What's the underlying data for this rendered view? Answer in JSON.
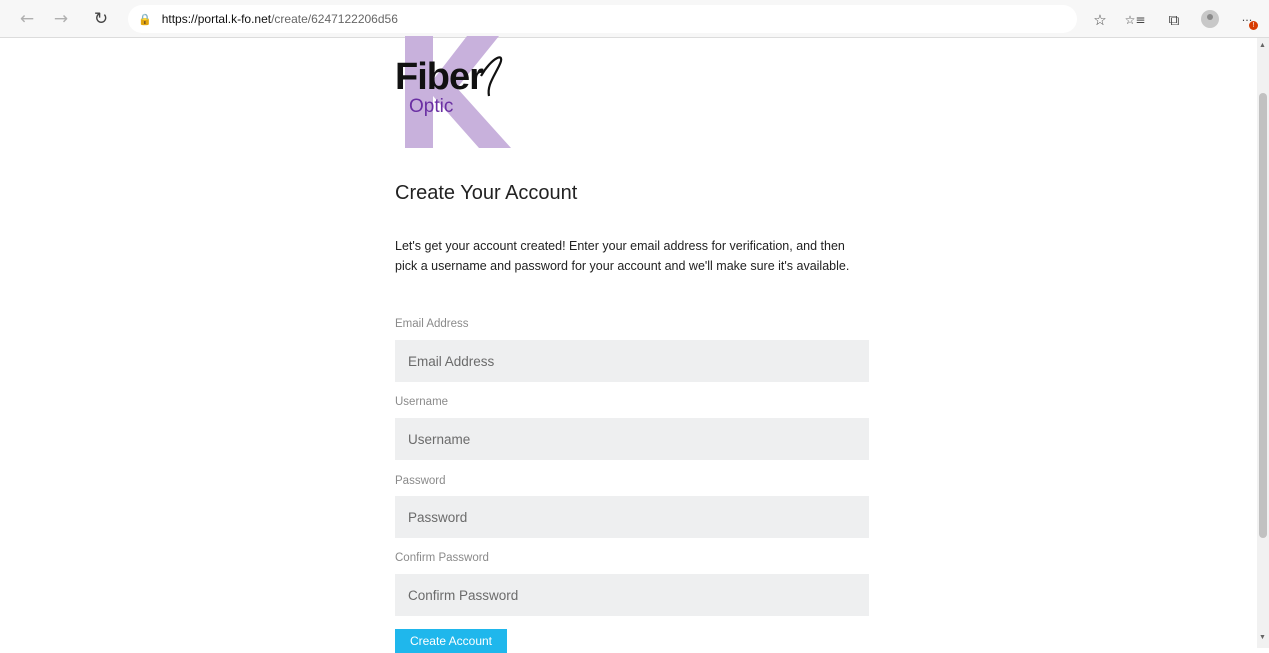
{
  "browser": {
    "back_icon": "←",
    "forward_icon": "→",
    "refresh_icon": "↻",
    "lock_icon": "🔒",
    "url_host": "https://portal.k-fo.net",
    "url_path": "/create/6247122206d56",
    "star_icon": "☆",
    "favorites_icon": "☆≡",
    "collections_icon": "⧉",
    "more_icon": "···",
    "badge_count": "!"
  },
  "logo": {
    "line1": "Fiber",
    "line2": "Optic",
    "monogram": "K",
    "colors": {
      "monogram": "#c8b1dc",
      "optic": "#6a2fa3"
    }
  },
  "form": {
    "title": "Create Your Account",
    "intro": "Let's get your account created! Enter your email address for verification, and then pick a username and password for your account and we'll make sure it's available.",
    "email_label": "Email Address",
    "email_placeholder": "Email Address",
    "username_label": "Username",
    "username_placeholder": "Username",
    "password_label": "Password",
    "password_placeholder": "Password",
    "confirm_label": "Confirm Password",
    "confirm_placeholder": "Confirm Password",
    "submit_label": "Create Account",
    "accent_color": "#1fb7ec"
  }
}
